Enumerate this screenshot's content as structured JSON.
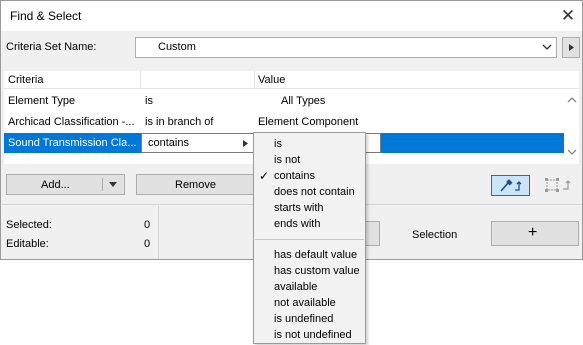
{
  "window": {
    "title": "Find & Select"
  },
  "criteria_set": {
    "label": "Criteria Set Name:",
    "value": "Custom"
  },
  "grid": {
    "headers": [
      "Criteria",
      "",
      "Value"
    ],
    "rows": [
      {
        "criteria": "Element Type",
        "operator": "is",
        "value": "All Types"
      },
      {
        "criteria": "Archicad Classification -...",
        "operator": "is in branch of",
        "value": "Element Component"
      },
      {
        "criteria": "Sound Transmission Cla...",
        "operator": "contains",
        "value": ""
      }
    ]
  },
  "buttons": {
    "add": "Add...",
    "remove": "Remove",
    "selection": "Selection",
    "plus": "+"
  },
  "stats": {
    "selected_label": "Selected:",
    "selected_value": "0",
    "editable_label": "Editable:",
    "editable_value": "0"
  },
  "operator_menu": {
    "group1": [
      "is",
      "is not",
      "contains",
      "does not contain",
      "starts with",
      "ends with"
    ],
    "group2": [
      "has default value",
      "has custom value",
      "available",
      "not available",
      "is undefined",
      "is not undefined"
    ],
    "checked": "contains"
  },
  "colors": {
    "selection": "#0078d7",
    "accent_light": "#cce4f7"
  }
}
